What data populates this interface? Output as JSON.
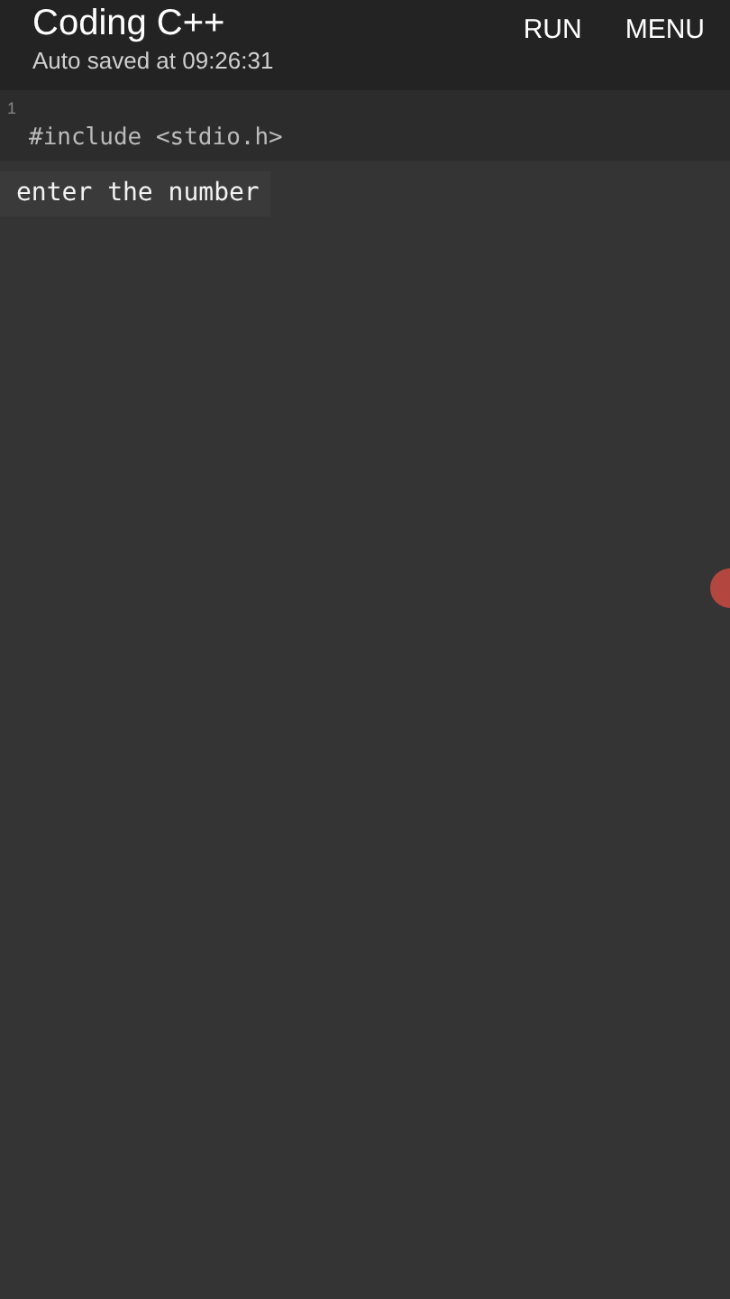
{
  "app_bar": {
    "title": "Coding C++",
    "subtitle": "Auto saved at 09:26:31",
    "actions": [
      "RUN",
      "MENU"
    ]
  },
  "editor": {
    "lines": [
      {
        "number": "1",
        "code": "#include <stdio.h>"
      }
    ]
  },
  "output": {
    "lines": [
      "enter the number"
    ]
  }
}
